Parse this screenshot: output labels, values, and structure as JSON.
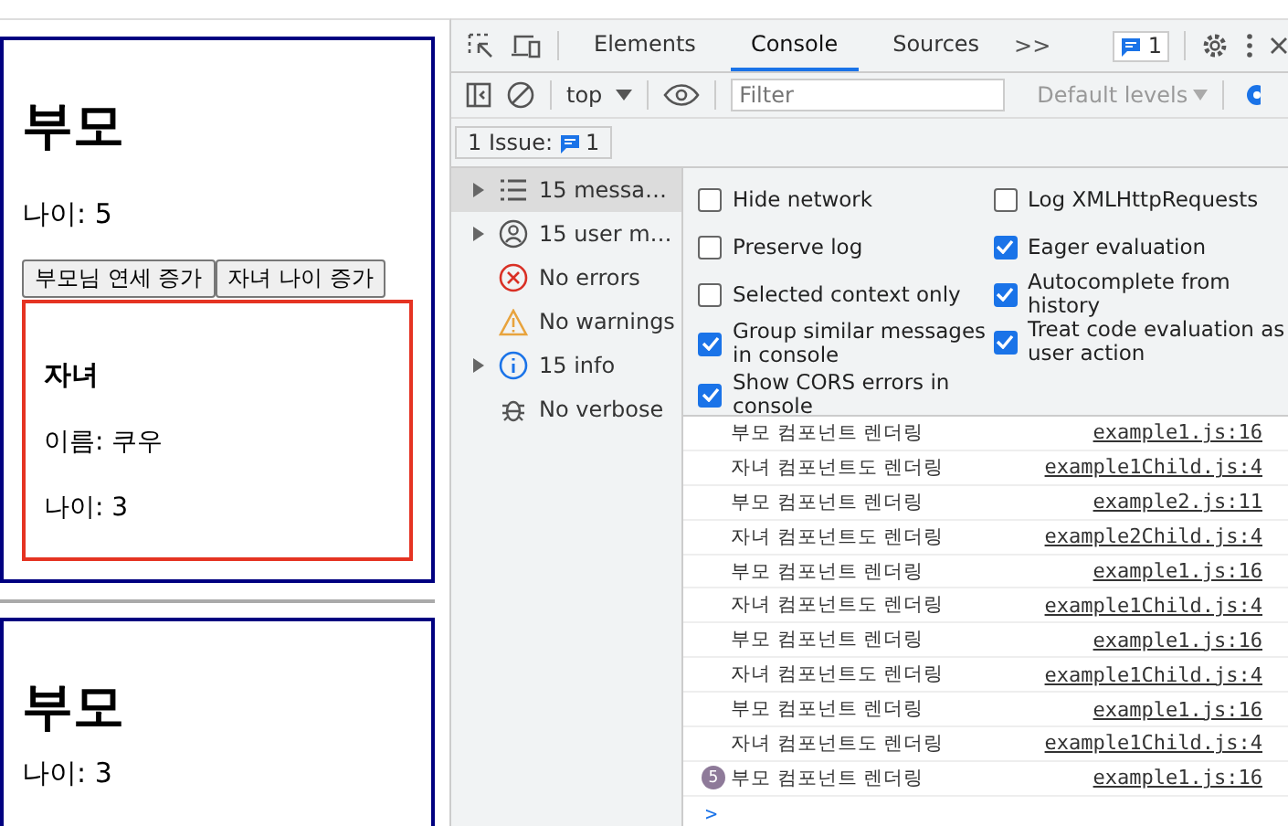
{
  "page": {
    "parents": [
      {
        "title": "부모",
        "age": "나이: 5",
        "buttons": [
          "부모님 연세 증가",
          "자녀 나이 증가"
        ],
        "child": {
          "title": "자녀",
          "name": "이름: 쿠우",
          "age": "나이: 3"
        }
      },
      {
        "title": "부모",
        "age": "나이: 3"
      }
    ]
  },
  "devtools": {
    "tabs": [
      {
        "label": "Elements",
        "selected": false
      },
      {
        "label": "Console",
        "selected": true
      },
      {
        "label": "Sources",
        "selected": false
      }
    ],
    "more_tabs": ">>",
    "issues_badge": "1",
    "context": "top",
    "filter": {
      "placeholder": "Filter"
    },
    "levels": "Default levels",
    "issues": {
      "label": "1 Issue:",
      "count": "1"
    },
    "sidebar": [
      {
        "kind": "list",
        "label": "15 messa…",
        "expandable": true,
        "selected": true
      },
      {
        "kind": "user",
        "label": "15 user m…",
        "expandable": true,
        "selected": false
      },
      {
        "kind": "error",
        "label": "No errors",
        "expandable": false,
        "selected": false
      },
      {
        "kind": "warning",
        "label": "No warnings",
        "expandable": false,
        "selected": false
      },
      {
        "kind": "info",
        "label": "15 info",
        "expandable": true,
        "selected": false
      },
      {
        "kind": "verbose",
        "label": "No verbose",
        "expandable": false,
        "selected": false
      }
    ],
    "settings_left": [
      {
        "label": "Hide network",
        "checked": false
      },
      {
        "label": "Preserve log",
        "checked": false
      },
      {
        "label": "Selected context only",
        "checked": false
      },
      {
        "label": "Group similar messages in console",
        "checked": true
      },
      {
        "label": "Show CORS errors in console",
        "checked": true
      }
    ],
    "settings_right": [
      {
        "label": "Log XMLHttpRequests",
        "checked": false
      },
      {
        "label": "Eager evaluation",
        "checked": true
      },
      {
        "label": "Autocomplete from history",
        "checked": true
      },
      {
        "label": "Treat code evaluation as user action",
        "checked": true
      }
    ],
    "messages": [
      {
        "text": "부모 컴포넌트 렌더링",
        "source": "example1.js:16"
      },
      {
        "text": "자녀 컴포넌트도 렌더링",
        "source": "example1Child.js:4"
      },
      {
        "text": "부모 컴포넌트 렌더링",
        "source": "example2.js:11"
      },
      {
        "text": "자녀 컴포넌트도 렌더링",
        "source": "example2Child.js:4"
      },
      {
        "text": "부모 컴포넌트 렌더링",
        "source": "example1.js:16"
      },
      {
        "text": "자녀 컴포넌트도 렌더링",
        "source": "example1Child.js:4"
      },
      {
        "text": "부모 컴포넌트 렌더링",
        "source": "example1.js:16"
      },
      {
        "text": "자녀 컴포넌트도 렌더링",
        "source": "example1Child.js:4"
      },
      {
        "text": "부모 컴포넌트 렌더링",
        "source": "example1.js:16"
      },
      {
        "text": "자녀 컴포넌트도 렌더링",
        "source": "example1Child.js:4"
      },
      {
        "text": "부모 컴포넌트 렌더링",
        "source": "example1.js:16",
        "repeat": "5"
      }
    ],
    "prompt": ">"
  }
}
